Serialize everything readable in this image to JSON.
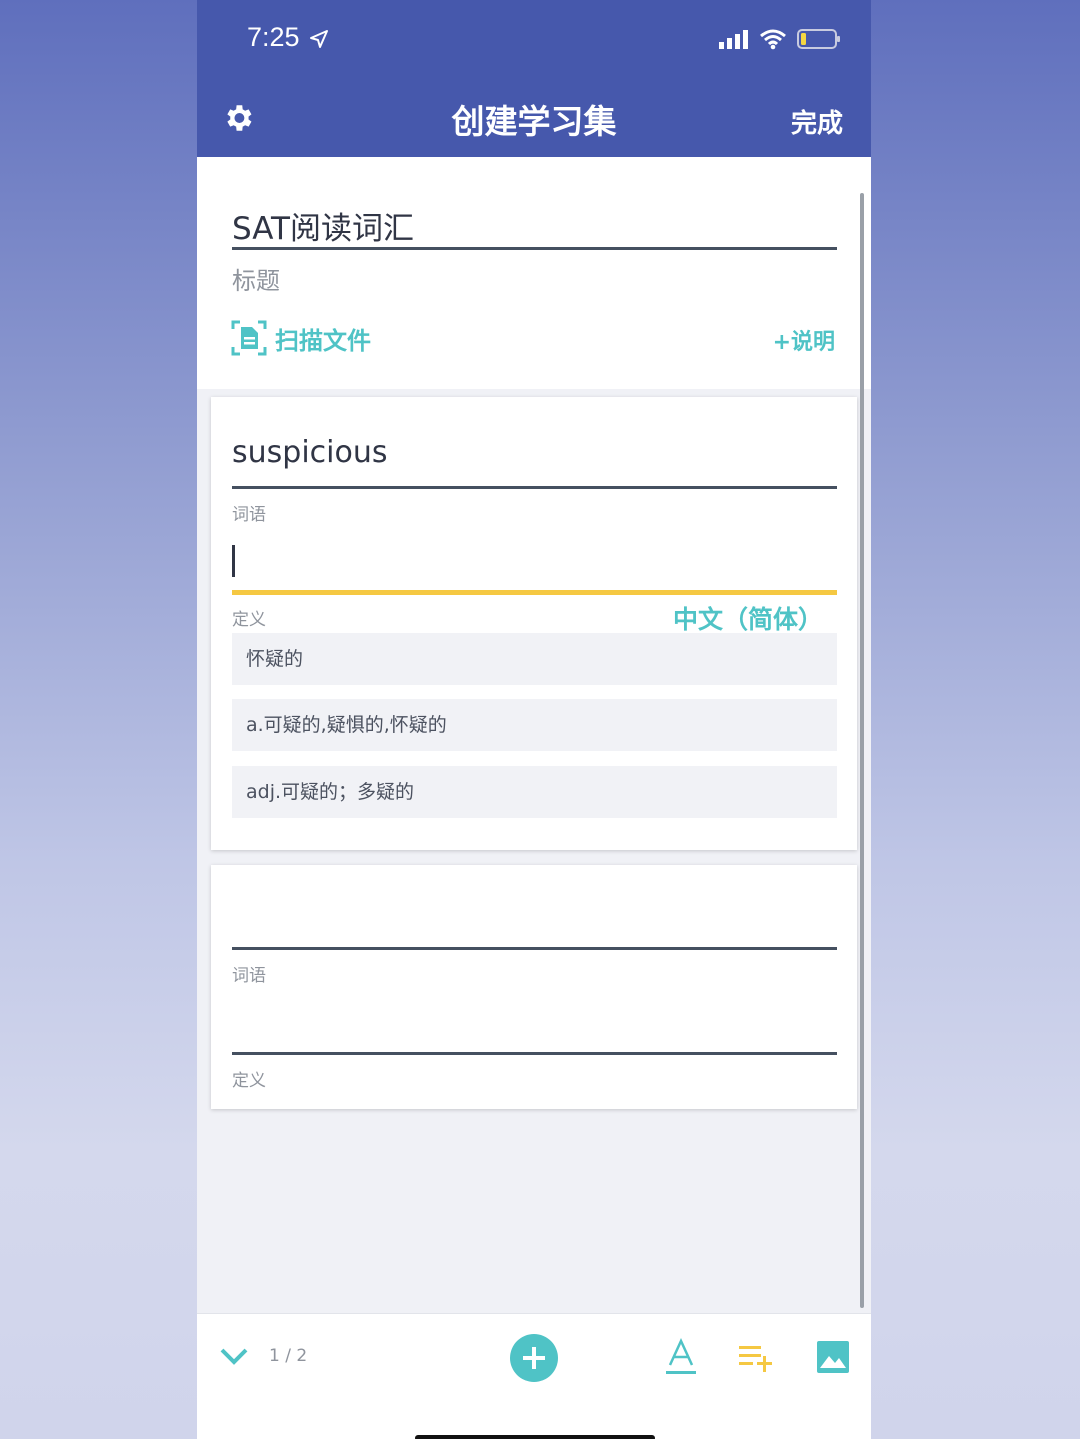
{
  "status": {
    "time": "7:25"
  },
  "nav": {
    "title": "创建学习集",
    "done": "完成"
  },
  "set": {
    "title_value": "SAT阅读词汇",
    "title_label": "标题",
    "scan": "扫描文件",
    "description": "+说明"
  },
  "cards": [
    {
      "word": "suspicious",
      "word_label": "词语",
      "definition_label": "定义",
      "language": "中文（简体）",
      "suggestions": [
        "怀疑的",
        "a.可疑的,疑惧的,怀疑的",
        "adj.可疑的；多疑的"
      ]
    },
    {
      "word_label": "词语",
      "definition_label": "定义"
    }
  ],
  "toolbar": {
    "pager": "1 / 2"
  },
  "colors": {
    "header": "#4658ac",
    "accent": "#4fc3c6",
    "focus_underline": "#f5c842"
  },
  "icons": [
    "gear-icon",
    "location-arrow-icon",
    "signal-icon",
    "wifi-icon",
    "battery-icon",
    "scan-document-icon",
    "chevron-down-icon",
    "plus-icon",
    "text-format-icon",
    "add-list-icon",
    "image-icon"
  ]
}
